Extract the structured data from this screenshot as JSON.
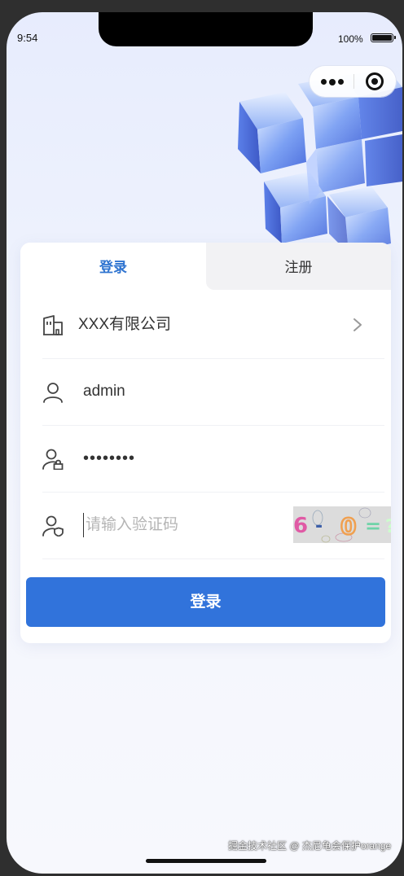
{
  "status_bar": {
    "time": "9:54",
    "battery_percent": "100%"
  },
  "tabs": {
    "login": "登录",
    "register": "注册"
  },
  "form": {
    "company": "XXX有限公司",
    "username": "admin",
    "password_masked": "••••••••",
    "captcha_placeholder": "请输入验证码",
    "captcha_text": "6-0=?"
  },
  "login_button": "登录",
  "watermark": "掘金技术社区 @ 杰尼龟会保护orange",
  "colors": {
    "accent": "#3173db",
    "active_tab": "#2f74d0",
    "inactive_tab_bg": "#f2f2f4"
  },
  "icons": {
    "company": "building-icon",
    "user": "user-icon",
    "password": "user-lock-icon",
    "captcha": "user-shield-icon",
    "chevron": "chevron-right-icon",
    "more": "more-dots-icon",
    "close": "target-icon"
  }
}
